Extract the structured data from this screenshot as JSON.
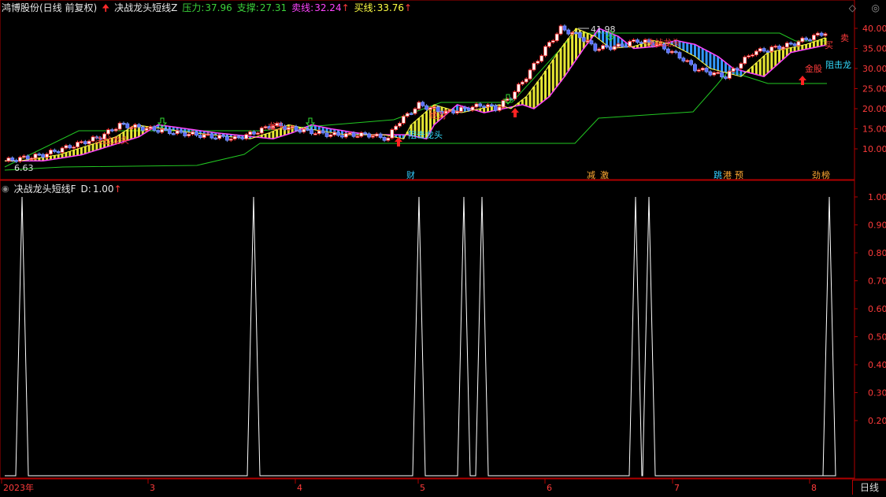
{
  "top_header": {
    "stock": "鸿博股份(日线 前复权)",
    "indicator": "决战龙头短线Z",
    "items": [
      {
        "label": "压力:",
        "value": "37.96",
        "color": "#3cd23c"
      },
      {
        "label": "支撑:",
        "value": "27.31",
        "color": "#3cd23c"
      },
      {
        "label": "卖线:",
        "value": "32.24",
        "color": "#ff44ff"
      },
      {
        "label": "买线:",
        "value": "33.76",
        "color": "#ffff44"
      }
    ],
    "arrow_glyph": "↑"
  },
  "bottom_header": {
    "indicator": "决战龙头短线F",
    "label": "D:",
    "value": "1.00",
    "arrow_glyph": "↑"
  },
  "top_axis_ticks": [
    "40.00",
    "35.00",
    "30.00",
    "25.00",
    "20.00",
    "15.00",
    "10.00"
  ],
  "bottom_axis_ticks": [
    "1.00",
    "0.90",
    "0.80",
    "0.70",
    "0.60",
    "0.50",
    "0.40",
    "0.30",
    "0.20"
  ],
  "x_axis_labels": [
    "2023年",
    "3",
    "4",
    "5",
    "6",
    "7",
    "8"
  ],
  "corner_label": "日线",
  "annotations": {
    "peak_price": "41.98",
    "low_price": "6.63",
    "event_labels": [
      "财",
      "减",
      "激",
      "跳",
      "港",
      "预",
      "劲",
      "榜"
    ],
    "chart_texts": [
      "决战龙头",
      "阻击龙头",
      "绝对",
      "龙头",
      "金股",
      "买",
      "卖",
      "决战龙头",
      "阻击龙"
    ]
  },
  "chart_data": {
    "type": "line",
    "series": [
      {
        "name": "D",
        "values": [
          0,
          0,
          1,
          0,
          0,
          0,
          0,
          0,
          0,
          0,
          0,
          1,
          0,
          0,
          0,
          0,
          0,
          0,
          1,
          0,
          1,
          1,
          0,
          0,
          0,
          0,
          1,
          1,
          0,
          0,
          0,
          0,
          0,
          1
        ]
      }
    ],
    "ylim": [
      0,
      1
    ],
    "candles_ohlc_note": ""
  }
}
